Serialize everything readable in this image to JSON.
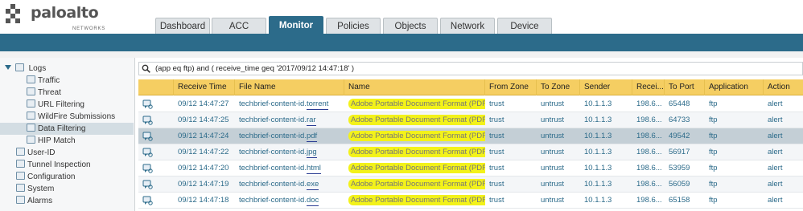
{
  "brand": {
    "name": "paloalto",
    "sub": "NETWORKS"
  },
  "tabs": [
    {
      "label": "Dashboard",
      "active": false
    },
    {
      "label": "ACC",
      "active": false
    },
    {
      "label": "Monitor",
      "active": true
    },
    {
      "label": "Policies",
      "active": false
    },
    {
      "label": "Objects",
      "active": false
    },
    {
      "label": "Network",
      "active": false
    },
    {
      "label": "Device",
      "active": false
    }
  ],
  "sidebar": {
    "group": "Logs",
    "items": [
      {
        "label": "Traffic",
        "selected": false
      },
      {
        "label": "Threat",
        "selected": false
      },
      {
        "label": "URL Filtering",
        "selected": false
      },
      {
        "label": "WildFire Submissions",
        "selected": false
      },
      {
        "label": "Data Filtering",
        "selected": true
      },
      {
        "label": "HIP Match",
        "selected": false
      },
      {
        "label": "User-ID",
        "selected": false
      },
      {
        "label": "Tunnel Inspection",
        "selected": false
      },
      {
        "label": "Configuration",
        "selected": false
      },
      {
        "label": "System",
        "selected": false
      },
      {
        "label": "Alarms",
        "selected": false
      }
    ]
  },
  "filter": {
    "query": "(app eq ftp) and ( receive_time geq '2017/09/12 14:47:18' )"
  },
  "table": {
    "columns": [
      "",
      "Receive Time",
      "File Name",
      "Name",
      "From Zone",
      "To Zone",
      "Sender",
      "Recei...",
      "To Port",
      "Application",
      "Action"
    ],
    "rows": [
      {
        "time": "09/12 14:47:27",
        "file_base": "techbrief-content-id.",
        "file_ext": "torrent",
        "name": "Adobe Portable Document Format (PDF)",
        "from_zone": "trust",
        "to_zone": "untrust",
        "sender": "10.1.1.3",
        "receiver": "198.6...",
        "to_port": "65448",
        "app": "ftp",
        "action": "alert",
        "selected": false
      },
      {
        "time": "09/12 14:47:25",
        "file_base": "techbrief-content-id.",
        "file_ext": "rar",
        "name": "Adobe Portable Document Format (PDF)",
        "from_zone": "trust",
        "to_zone": "untrust",
        "sender": "10.1.1.3",
        "receiver": "198.6...",
        "to_port": "64733",
        "app": "ftp",
        "action": "alert",
        "selected": false
      },
      {
        "time": "09/12 14:47:24",
        "file_base": "techbrief-content-id.",
        "file_ext": "pdf",
        "name": "Adobe Portable Document Format (PDF)",
        "from_zone": "trust",
        "to_zone": "untrust",
        "sender": "10.1.1.3",
        "receiver": "198.6...",
        "to_port": "49542",
        "app": "ftp",
        "action": "alert",
        "selected": true
      },
      {
        "time": "09/12 14:47:22",
        "file_base": "techbrief-content-id.",
        "file_ext": "jpg",
        "name": "Adobe Portable Document Format (PDF)",
        "from_zone": "trust",
        "to_zone": "untrust",
        "sender": "10.1.1.3",
        "receiver": "198.6...",
        "to_port": "56917",
        "app": "ftp",
        "action": "alert",
        "selected": false
      },
      {
        "time": "09/12 14:47:20",
        "file_base": "techbrief-content-id.",
        "file_ext": "html",
        "name": "Adobe Portable Document Format (PDF)",
        "from_zone": "trust",
        "to_zone": "untrust",
        "sender": "10.1.1.3",
        "receiver": "198.6...",
        "to_port": "53959",
        "app": "ftp",
        "action": "alert",
        "selected": false
      },
      {
        "time": "09/12 14:47:19",
        "file_base": "techbrief-content-id.",
        "file_ext": "exe",
        "name": "Adobe Portable Document Format (PDF)",
        "from_zone": "trust",
        "to_zone": "untrust",
        "sender": "10.1.1.3",
        "receiver": "198.6...",
        "to_port": "56059",
        "app": "ftp",
        "action": "alert",
        "selected": false
      },
      {
        "time": "09/12 14:47:18",
        "file_base": "techbrief-content-id.",
        "file_ext": "doc",
        "name": "Adobe Portable Document Format (PDF)",
        "from_zone": "trust",
        "to_zone": "untrust",
        "sender": "10.1.1.3",
        "receiver": "198.6...",
        "to_port": "65158",
        "app": "ftp",
        "action": "alert",
        "selected": false
      }
    ]
  },
  "colors": {
    "accent": "#2c6b8a",
    "header": "#f5ce62",
    "highlight": "#f3f21a"
  }
}
